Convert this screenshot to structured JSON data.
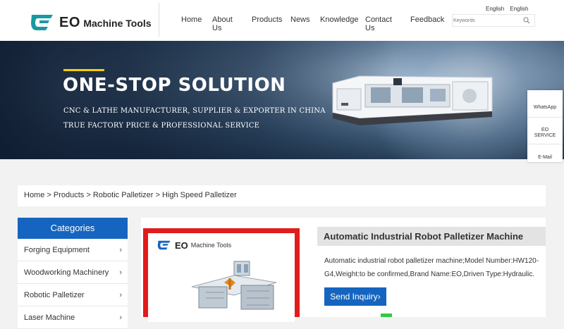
{
  "header": {
    "logo_brand": "EO",
    "logo_suffix": "Machine Tools",
    "nav": [
      "Home",
      "About Us",
      "Products",
      "News",
      "Knowledge",
      "Contact Us",
      "Feedback"
    ],
    "language": [
      "English",
      "English"
    ],
    "search_placeholder": "Keywords",
    "icons": {
      "search": "search-icon",
      "logo": "eo-logo-icon"
    }
  },
  "banner": {
    "title": "ONE-STOP SOLUTION",
    "line1": "CNC & LATHE MANUFACTURER, SUPPLIER & EXPORTER IN CHINA",
    "line2": "TRUE FACTORY PRICE & PROFESSIONAL SERVICE",
    "accent": "#ffcc00"
  },
  "float_tools": {
    "whatsapp": "WhatsApp",
    "service_line1": "EO",
    "service_line2": "SERVICE",
    "email": "E-Mail"
  },
  "breadcrumb": [
    "Home",
    "Products",
    "Robotic Palletizer",
    "High Speed Palletizer"
  ],
  "sidebar": {
    "heading": "Categories",
    "items": [
      "Forging Equipment",
      "Woodworking Machinery",
      "Robotic Palletizer",
      "Laser Machine"
    ]
  },
  "product": {
    "image_logo_brand": "EO",
    "image_logo_suffix": "Machine Tools",
    "title": "Automatic Industrial Robot Palletizer Machine",
    "description": "Automatic industrial robot palletizer machine;Model Number:HW120-G4,Weight:to be confirmed,Brand Name:EO,Driven Type:Hydraulic.",
    "inquiry_label": "Send Inquiry"
  },
  "colors": {
    "primary": "#1565c0",
    "image_border": "#e21b1b",
    "logo_teal": "#1a9aa0"
  }
}
